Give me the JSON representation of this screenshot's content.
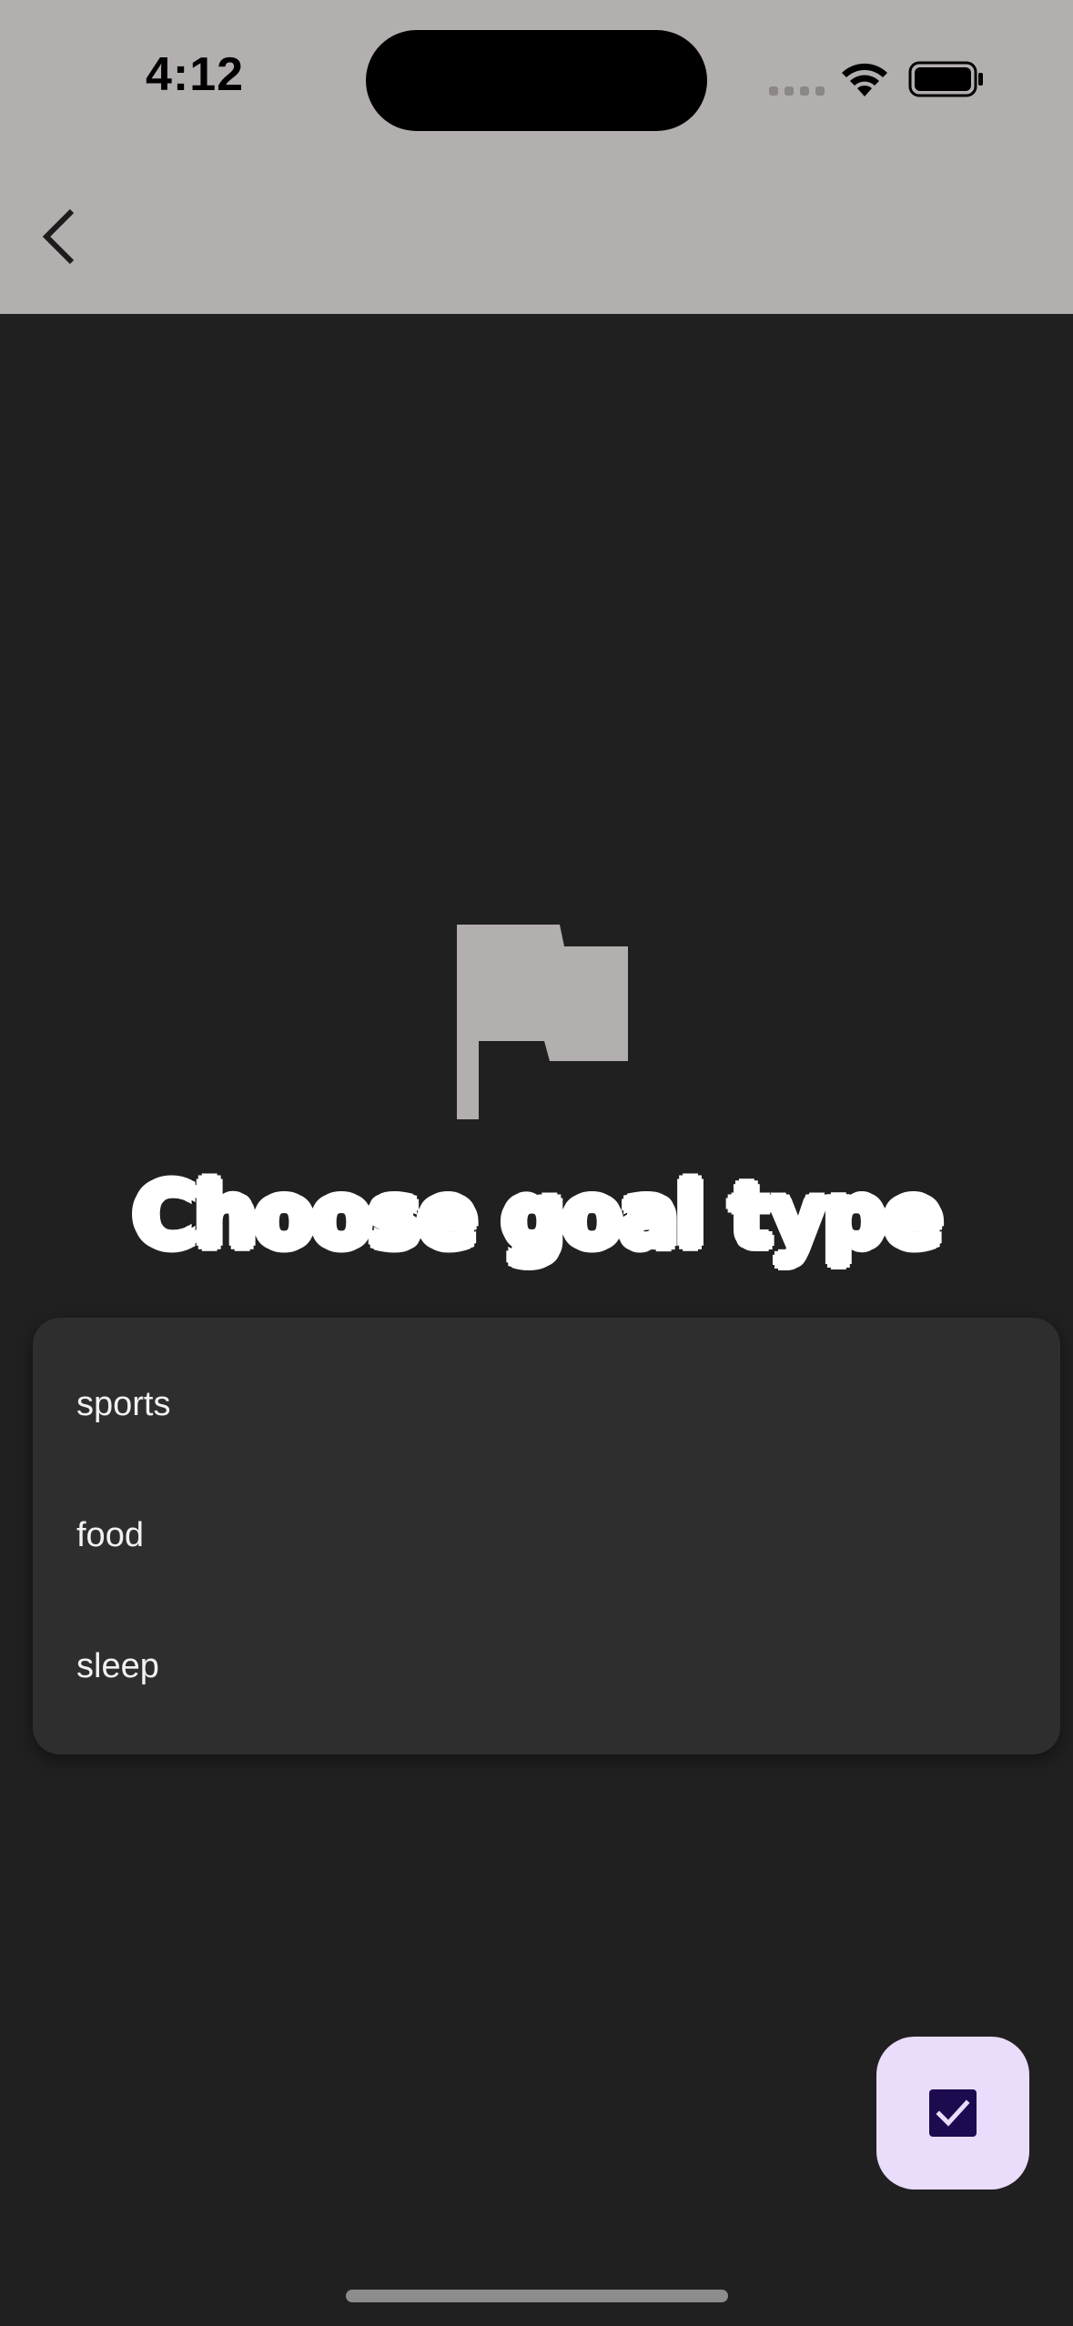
{
  "status_bar": {
    "time": "4:12"
  },
  "nav": {
    "back_icon": "chevron-left-icon"
  },
  "header": {
    "icon": "flag-icon",
    "title": "Choose goal type"
  },
  "options": [
    {
      "label": "sports"
    },
    {
      "label": "food"
    },
    {
      "label": "sleep"
    }
  ],
  "fab": {
    "icon": "checkbox-checked-icon"
  },
  "colors": {
    "top_bar": "#b3afae",
    "background": "#202020",
    "card": "#2e2e2e",
    "fab_background": "#eadcfb",
    "fab_icon": "#1d0b4f",
    "flag": "#b3afae"
  }
}
